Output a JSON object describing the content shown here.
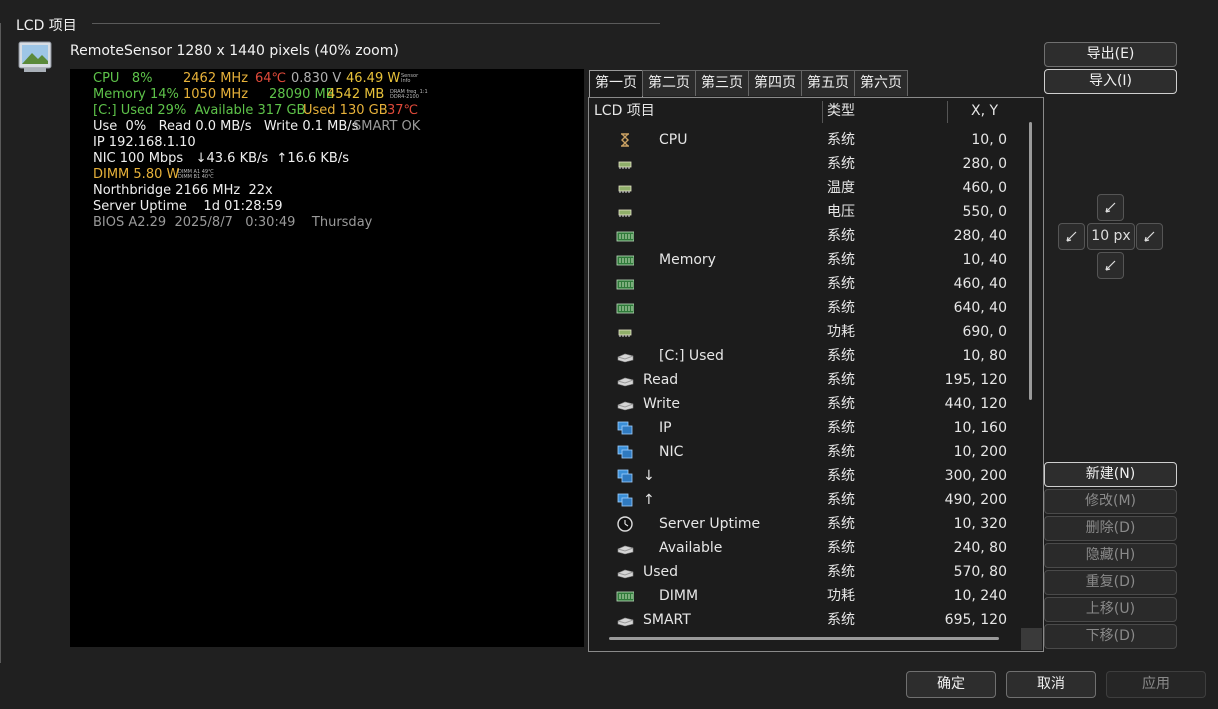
{
  "group": {
    "title": "LCD 项目"
  },
  "preview": {
    "label": "RemoteSensor 1280 x 1440 pixels (40% zoom)",
    "lines": [
      {
        "segments": [
          {
            "text": "CPU   8%",
            "color": "#5ec34a"
          },
          {
            "text": "2462 MHz",
            "color": "#e8b23a"
          },
          {
            "text": "64℃",
            "color": "#e04a3a"
          },
          {
            "text": "0.830 V",
            "color": "#b0b0b0"
          },
          {
            "text": "46.49 W",
            "color": "#e8c23a"
          }
        ]
      },
      {
        "segments": [
          {
            "text": "Memory 14%",
            "color": "#5ec34a"
          },
          {
            "text": "1050 MHz",
            "color": "#e8b23a"
          },
          {
            "text": "28090 MB",
            "color": "#5ec34a"
          },
          {
            "text": "4542 MB",
            "color": "#e8c23a"
          }
        ]
      },
      {
        "segments": [
          {
            "text": "[C:] Used 29%  Available 317 GB",
            "color": "#5ec34a"
          },
          {
            "text": "Used 130 GB",
            "color": "#e8b23a"
          },
          {
            "text": "37℃",
            "color": "#e04a3a"
          }
        ]
      },
      {
        "segments": [
          {
            "text": "Use  0%   Read 0.0 MB/s   Write 0.1 MB/s",
            "color": "#f0f0f0"
          },
          {
            "text": "SMART OK",
            "color": "#9a9a9a"
          }
        ]
      },
      {
        "segments": [
          {
            "text": "IP 192.168.1.10",
            "color": "#f0f0f0"
          }
        ]
      },
      {
        "segments": [
          {
            "text": "NIC 100 Mbps   ↓43.6 KB/s  ↑16.6 KB/s",
            "color": "#f0f0f0"
          }
        ]
      },
      {
        "segments": [
          {
            "text": "DIMM 5.80 W",
            "color": "#e8b23a"
          }
        ]
      },
      {
        "segments": [
          {
            "text": "Northbridge 2166 MHz  22x",
            "color": "#f0f0f0"
          }
        ]
      },
      {
        "segments": [
          {
            "text": "Server Uptime    1d 01:28:59",
            "color": "#f0f0f0"
          }
        ]
      },
      {
        "segments": [
          {
            "text": "BIOS A2.29  2025/8/7   0:30:49    Thursday",
            "color": "#9a9a9a"
          }
        ]
      }
    ]
  },
  "tabs": [
    "第一页",
    "第二页",
    "第三页",
    "第四页",
    "第五页",
    "第六页"
  ],
  "list": {
    "columns": [
      "LCD 项目",
      "类型",
      "X, Y"
    ],
    "rows": [
      {
        "icon": "hourglass-icon",
        "indent": 1,
        "name": "CPU",
        "type": "系统",
        "xy": "10, 0"
      },
      {
        "icon": "chip-icon",
        "indent": 1,
        "name": "",
        "type": "系统",
        "xy": "280, 0"
      },
      {
        "icon": "chip-icon",
        "indent": 1,
        "name": "",
        "type": "温度",
        "xy": "460, 0"
      },
      {
        "icon": "chip-icon",
        "indent": 1,
        "name": "",
        "type": "电压",
        "xy": "550, 0"
      },
      {
        "icon": "memory-icon",
        "indent": 1,
        "name": "",
        "type": "系统",
        "xy": "280, 40"
      },
      {
        "icon": "memory-icon",
        "indent": 1,
        "name": "Memory",
        "type": "系统",
        "xy": "10, 40"
      },
      {
        "icon": "memory-icon",
        "indent": 1,
        "name": "",
        "type": "系统",
        "xy": "460, 40"
      },
      {
        "icon": "memory-icon",
        "indent": 1,
        "name": "",
        "type": "系统",
        "xy": "640, 40"
      },
      {
        "icon": "chip-icon",
        "indent": 1,
        "name": "",
        "type": "功耗",
        "xy": "690, 0"
      },
      {
        "icon": "drive-icon",
        "indent": 1,
        "name": "[C:] Used",
        "type": "系统",
        "xy": "10, 80"
      },
      {
        "icon": "drive-icon",
        "indent": 0,
        "name": "Read",
        "type": "系统",
        "xy": "195, 120"
      },
      {
        "icon": "drive-icon",
        "indent": 0,
        "name": "Write",
        "type": "系统",
        "xy": "440, 120"
      },
      {
        "icon": "network-icon",
        "indent": 1,
        "name": "IP",
        "type": "系统",
        "xy": "10, 160"
      },
      {
        "icon": "network-icon",
        "indent": 1,
        "name": "NIC",
        "type": "系统",
        "xy": "10, 200"
      },
      {
        "icon": "network-icon",
        "indent": 0,
        "name": "↓",
        "type": "系统",
        "xy": "300, 200"
      },
      {
        "icon": "network-icon",
        "indent": 0,
        "name": "↑",
        "type": "系统",
        "xy": "490, 200"
      },
      {
        "icon": "clock-icon",
        "indent": 1,
        "name": "Server Uptime",
        "type": "系统",
        "xy": "10, 320"
      },
      {
        "icon": "drive-icon",
        "indent": 1,
        "name": "Available",
        "type": "系统",
        "xy": "240, 80"
      },
      {
        "icon": "drive-icon",
        "indent": 0,
        "name": "Used",
        "type": "系统",
        "xy": "570, 80"
      },
      {
        "icon": "memory-icon",
        "indent": 1,
        "name": "DIMM",
        "type": "功耗",
        "xy": "10, 240"
      },
      {
        "icon": "drive-icon",
        "indent": 0,
        "name": "SMART",
        "type": "系统",
        "xy": "695, 120"
      }
    ]
  },
  "buttons": {
    "export": "导出(E)",
    "import": "导入(I)",
    "step": "10 px",
    "new": "新建(N)",
    "modify": "修改(M)",
    "delete": "删除(D)",
    "hide": "隐藏(H)",
    "duplicate": "重复(D)",
    "move_up": "上移(U)",
    "move_down": "下移(D)",
    "ok": "确定",
    "cancel": "取消",
    "apply": "应用"
  }
}
